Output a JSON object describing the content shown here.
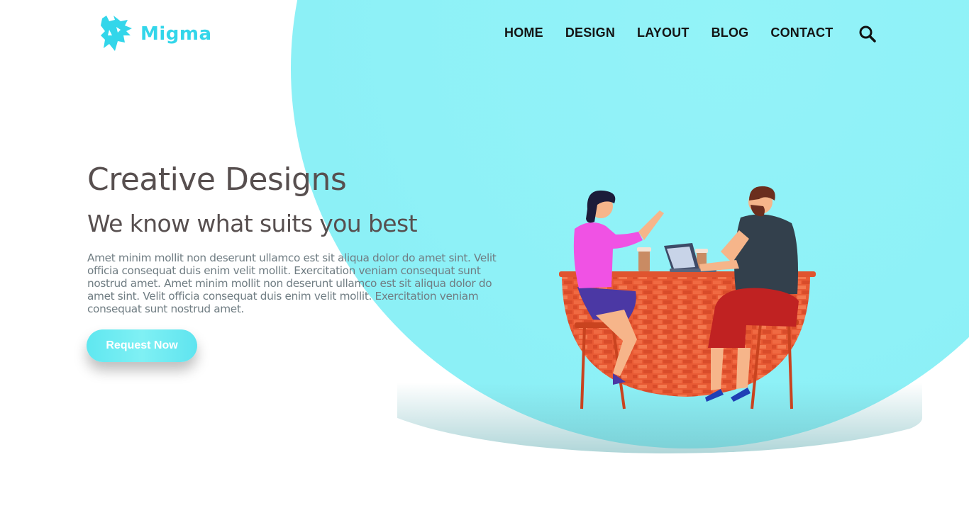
{
  "brand": {
    "name": "Migma",
    "accent_color": "#33d6ea",
    "logo_icon": "migma-bird-logo"
  },
  "nav": {
    "items": [
      {
        "label": "HOME"
      },
      {
        "label": "DESIGN"
      },
      {
        "label": "LAYOUT"
      },
      {
        "label": "BLOG"
      },
      {
        "label": "CONTACT"
      }
    ],
    "search_icon": "search-icon"
  },
  "hero": {
    "title": "Creative Designs",
    "subtitle": "We know what suits you best",
    "body": "Amet minim mollit non deserunt ullamco est sit aliqua dolor do amet sint. Velit officia consequat duis enim velit mollit. Exercitation veniam consequat sunt nostrud amet. Amet minim mollit non deserunt ullamco est sit aliqua dolor do amet sint. Velit officia consequat duis enim velit mollit. Exercitation veniam consequat sunt nostrud amet.",
    "cta_label": "Request Now",
    "cta_color": "#6eecf3",
    "text_color": "#574f4f",
    "background_circle_color": "#8ef1f7"
  },
  "illustration": {
    "subject": "two-people-chatting-at-brick-bar-with-laptop"
  }
}
